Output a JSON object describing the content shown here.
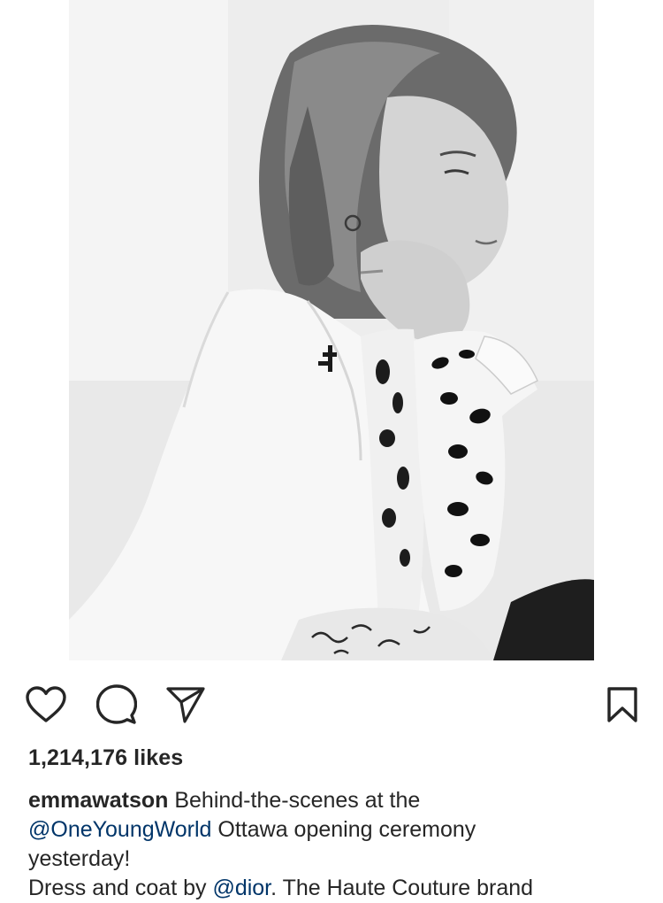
{
  "post": {
    "image_alt": "",
    "actions": {
      "like_icon": "heart-icon",
      "comment_icon": "speech-bubble-icon",
      "share_icon": "paper-plane-icon",
      "save_icon": "bookmark-icon"
    },
    "likes_text": "1,214,176 likes",
    "caption": {
      "username": "emmawatson",
      "line1_text": " Behind-the-scenes at the",
      "line2_mention": "@OneYoungWorld",
      "line2_text": " Ottawa opening ceremony",
      "line3_text": "yesterday!",
      "line4_text_before": "Dress and coat by ",
      "line4_mention": "@dior",
      "line4_text_after": ". The Haute Couture brand"
    }
  },
  "colors": {
    "text": "#262626",
    "mention": "#003569",
    "icon": "#262626"
  }
}
